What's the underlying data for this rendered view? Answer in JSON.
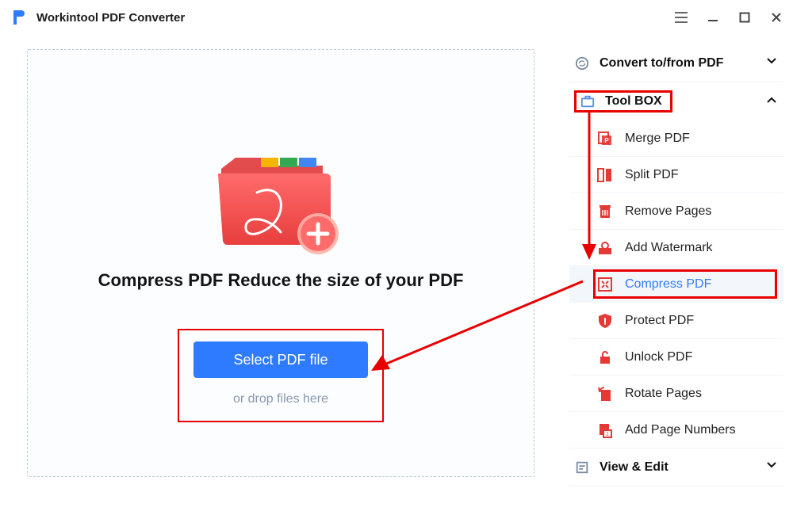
{
  "app": {
    "title": "Workintool PDF Converter"
  },
  "main": {
    "heading": "Compress PDF Reduce the size of your PDF",
    "select_button": "Select PDF file",
    "drop_hint": "or drop files here"
  },
  "sidebar": {
    "sections": {
      "convert": {
        "label": "Convert to/from PDF"
      },
      "toolbox": {
        "label": "Tool BOX"
      },
      "view_edit": {
        "label": "View & Edit"
      }
    },
    "tools": [
      {
        "id": "merge",
        "label": "Merge PDF"
      },
      {
        "id": "split",
        "label": "Split PDF"
      },
      {
        "id": "remove",
        "label": "Remove Pages"
      },
      {
        "id": "watermark",
        "label": "Add Watermark"
      },
      {
        "id": "compress",
        "label": "Compress PDF",
        "active": true
      },
      {
        "id": "protect",
        "label": "Protect PDF"
      },
      {
        "id": "unlock",
        "label": "Unlock PDF"
      },
      {
        "id": "rotate",
        "label": "Rotate Pages"
      },
      {
        "id": "pagenum",
        "label": "Add Page Numbers"
      }
    ]
  },
  "colors": {
    "accent": "#2F7BFF",
    "highlight": "#e80000"
  }
}
